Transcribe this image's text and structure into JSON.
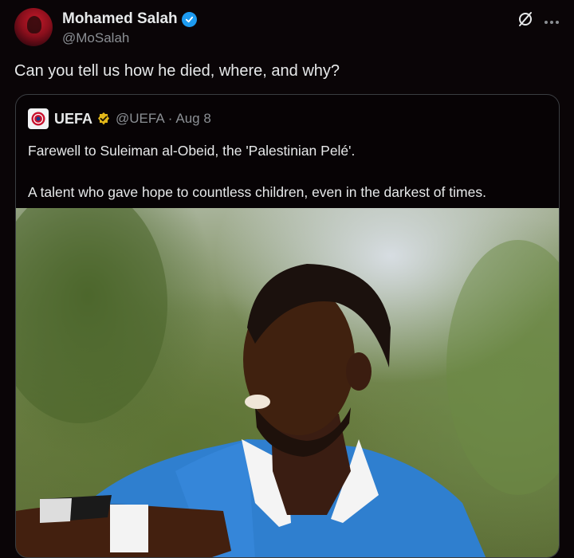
{
  "tweet": {
    "display_name": "Mohamed Salah",
    "handle": "@MoSalah",
    "text": "Can you tell us how he died, where, and why?"
  },
  "top_icons": [
    "grok-icon",
    "more-icon"
  ],
  "quoted_tweet": {
    "display_name": "UEFA",
    "handle": "@UEFA",
    "separator": "·",
    "date": "Aug 8",
    "paragraphs": [
      "Farewell to Suleiman al-Obeid, the 'Palestinian Pelé'.",
      "A talent who gave hope to countless children, even in the darkest of times."
    ]
  },
  "colors": {
    "background": "#0a0507",
    "verified_blue": "#1d9bf0",
    "affiliate_gold": "#e2b719",
    "muted_text": "#8b8f94"
  }
}
